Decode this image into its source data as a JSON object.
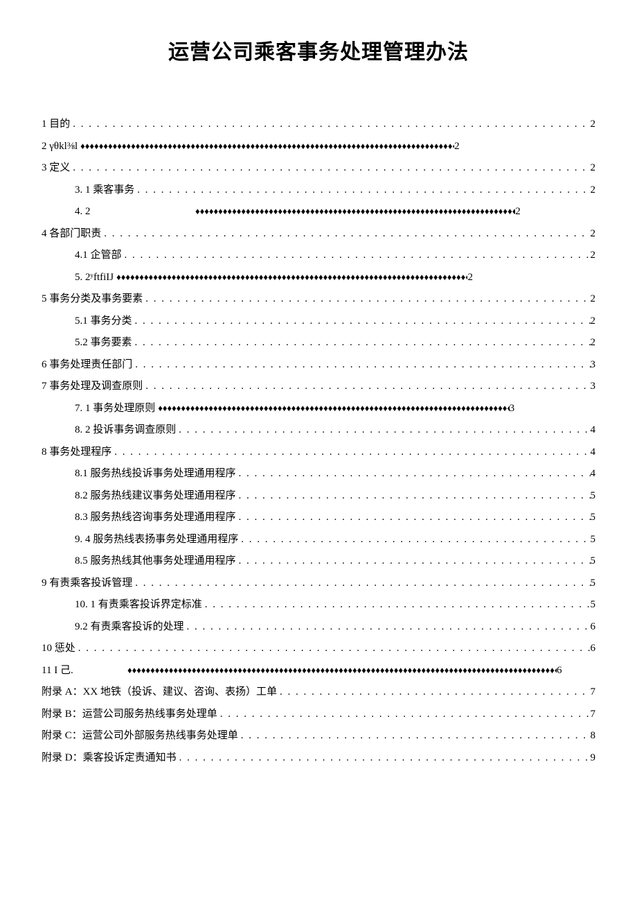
{
  "title": "运营公司乘客事务处理管理办法",
  "toc": [
    {
      "level": 1,
      "label": "1 目的",
      "leader": "dots",
      "page": "2"
    },
    {
      "level": 1,
      "label": "2    γθkl⅜l",
      "leader": "diam",
      "page": "2",
      "cls": "diamond-row"
    },
    {
      "level": 1,
      "label": "3 定义",
      "leader": "dots",
      "page": "2"
    },
    {
      "level": 2,
      "label": "3.  1 乘客事务",
      "leader": "dots",
      "page": "2"
    },
    {
      "level": 2,
      "label": "4.  2",
      "leader": "diam",
      "page": "2",
      "cls": "diamond-row row-4-2"
    },
    {
      "level": 1,
      "label": "4 各部门职责",
      "leader": "dots",
      "page": "2"
    },
    {
      "level": 2,
      "label": "4.1    企管部",
      "leader": "dots",
      "page": "2"
    },
    {
      "level": 2,
      "label": "5.  2ʸftfiIJ",
      "leader": "diam",
      "page": "2",
      "cls": "diamond-row"
    },
    {
      "level": 1,
      "label": "5 事务分类及事务要素",
      "leader": "dots",
      "page": "2"
    },
    {
      "level": 2,
      "label": "5.1    事务分类",
      "leader": "dots",
      "page": "2"
    },
    {
      "level": 2,
      "label": "5.2    事务要素",
      "leader": "dots",
      "page": "2"
    },
    {
      "level": 1,
      "label": "6 事务处理责任部门",
      "leader": "dots",
      "page": "3"
    },
    {
      "level": 1,
      "label": "7 事务处理及调查原则",
      "leader": "dots",
      "page": "3"
    },
    {
      "level": 2,
      "label": "7.  1 事务处理原则",
      "leader": "diam",
      "page": "3",
      "cls": "diamond-row"
    },
    {
      "level": 2,
      "label": "8.  2 投诉事务调查原则 ",
      "leader": "dots",
      "page": "4"
    },
    {
      "level": 1,
      "label": "8 事务处理程序",
      "leader": "dots",
      "page": "4"
    },
    {
      "level": 2,
      "label": "8.1    服务热线投诉事务处理通用程序",
      "leader": "dots",
      "page": "4"
    },
    {
      "level": 2,
      "label": "8.2    服务热线建议事务处理通用程序",
      "leader": "dots",
      "page": "5"
    },
    {
      "level": 2,
      "label": "8.3    服务热线咨询事务处理通用程序",
      "leader": "dots",
      "page": "5"
    },
    {
      "level": 2,
      "label": "9.  4 服务热线表扬事务处理通用程序 ",
      "leader": "dots",
      "page": "5"
    },
    {
      "level": 2,
      "label": "8.5 服务热线其他事务处理通用程序",
      "leader": "dots",
      "page": "5"
    },
    {
      "level": 1,
      "label": "9 有责乘客投诉管理",
      "leader": "dots",
      "page": "5"
    },
    {
      "level": 2,
      "label": "10. 1 有责乘客投诉界定标准 ",
      "leader": "dots",
      "page": "5"
    },
    {
      "level": 2,
      "label": "9.2 有责乘客投诉的处理",
      "leader": "dots",
      "page": "6"
    },
    {
      "level": 1,
      "label": "10   惩处",
      "leader": "dots",
      "page": "6"
    },
    {
      "level": 1,
      "label": "11         I 己. ",
      "leader": "diam",
      "page": "6",
      "cls": "diamond-row row-11"
    },
    {
      "level": 1,
      "label": "附录 A：XX 地铁（投诉、建议、咨询、表扬）工单 ",
      "leader": "dots",
      "page": "7"
    },
    {
      "level": 1,
      "label": "附录 B：运营公司服务热线事务处理单",
      "leader": "dots",
      "page": "7"
    },
    {
      "level": 1,
      "label": "附录 C：运营公司外部服务热线事务处理单",
      "leader": "dots",
      "page": "8"
    },
    {
      "level": 1,
      "label": "附录 D：乘客投诉定责通知书 ",
      "leader": "dots",
      "page": "9"
    }
  ]
}
